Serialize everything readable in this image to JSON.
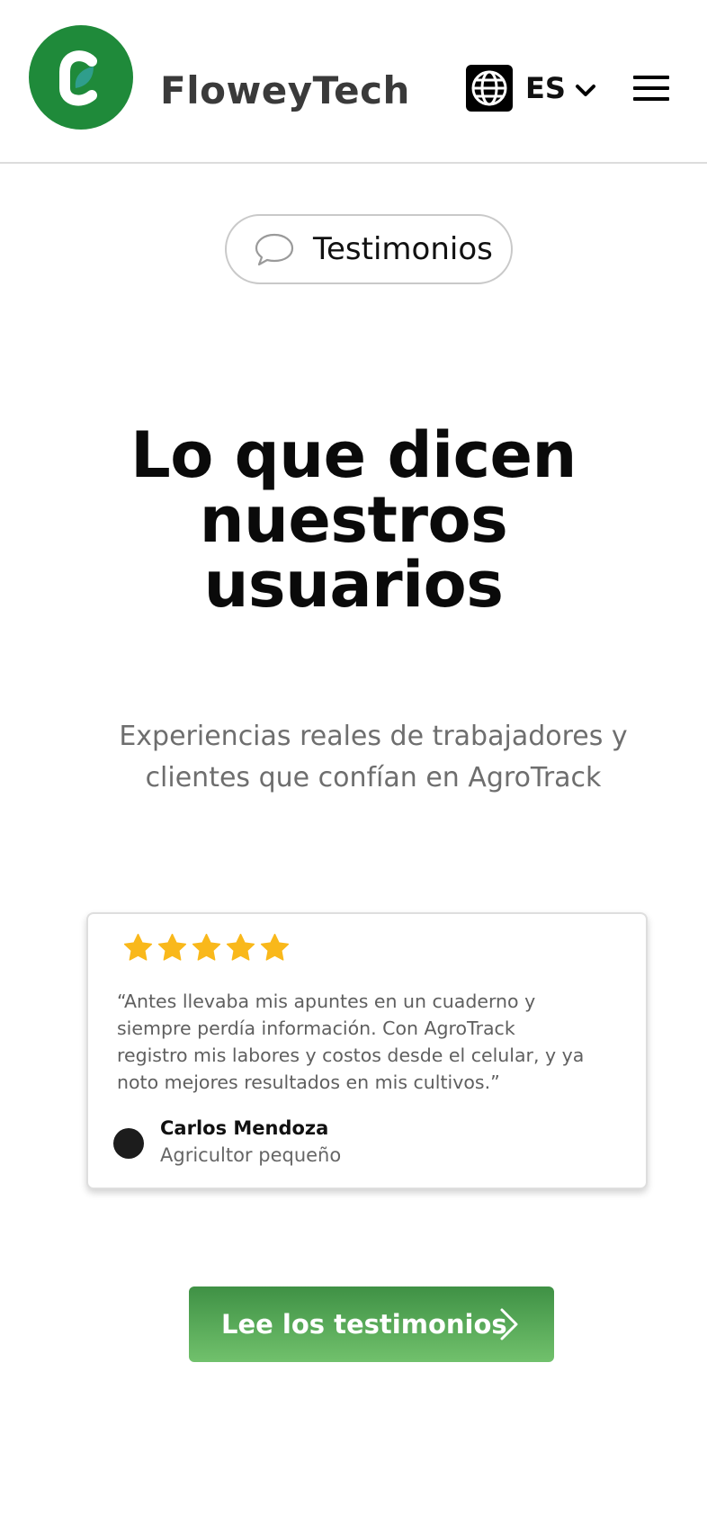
{
  "header": {
    "brand": "FloweyTech",
    "language": "ES"
  },
  "section": {
    "pill_label": "Testimonios",
    "title_lines": [
      "Lo que dicen",
      "nuestros",
      "usuarios"
    ],
    "subtitle": "Experiencias reales de trabajadores y clientes que confían en AgroTrack"
  },
  "testimonial": {
    "rating": 5,
    "rating_max": 5,
    "quote": "“Antes llevaba mis apuntes en un cuaderno y siempre perdía información. Con AgroTrack registro mis labores y costos desde el celular, y ya noto mejores resultados en mis cultivos.”",
    "author_name": "Carlos Mendoza",
    "author_role": "Agricultor pequeño"
  },
  "cta": {
    "label": "Lee los testimonios"
  },
  "colors": {
    "brand_green": "#1f8a3a",
    "star": "#f9b81b",
    "cta_top": "#3f9145",
    "cta_bottom": "#71c16c"
  },
  "icons": {
    "logo": "leaf-c-logo",
    "language": "globe-icon",
    "dropdown": "chevron-down-icon",
    "menu": "hamburger-menu-icon",
    "pill": "speech-bubble-icon",
    "rating": "star-icon",
    "cta": "chevron-right-icon"
  }
}
